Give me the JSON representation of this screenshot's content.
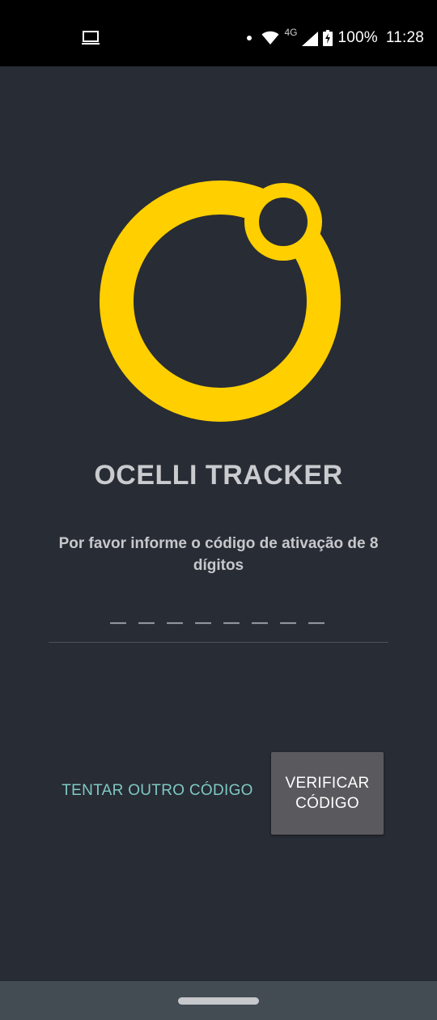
{
  "status_bar": {
    "network_type": "4G",
    "battery": "100%",
    "time": "11:28",
    "icons": [
      "laptop-icon",
      "dot-icon",
      "wifi-icon",
      "signal-icon",
      "battery-charging-icon"
    ]
  },
  "logo": {
    "icon": "ocelli-logo-icon",
    "color": "#ffcf00"
  },
  "app": {
    "title": "OCELLI TRACKER",
    "instruction": "Por favor informe o código de ativação de 8 dígitos"
  },
  "code_field": {
    "placeholder": "— — — — — — — —",
    "value": ""
  },
  "actions": {
    "retry_label": "TENTAR OUTRO CÓDIGO",
    "verify_label": "VERIFICAR CÓDIGO"
  },
  "colors": {
    "background": "#282c34",
    "accent_link": "#7fc9c4",
    "button_bg": "#5a5a5e",
    "nav_bar": "#434b53"
  }
}
